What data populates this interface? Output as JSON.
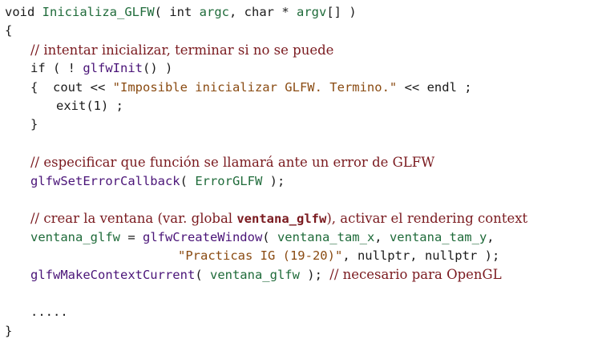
{
  "code": {
    "l1": {
      "kw_void": "void",
      "fname": "Inicializa_GLFW",
      "open": "( ",
      "kw_int": "int",
      "argc": "argc",
      "comma": ", ",
      "kw_char": "char",
      "star": " * ",
      "argv": "argv",
      "close": "[] )"
    },
    "l2": {
      "brace": "{"
    },
    "l3": {
      "comment": "// intentar inicializar, terminar si no se puede"
    },
    "l4": {
      "pre": "if ( ! ",
      "call": "glfwInit",
      "post": "() )"
    },
    "l5": {
      "pre": "{  cout << ",
      "str": "\"Imposible inicializar GLFW. Termino.\"",
      "post": " << endl ;"
    },
    "l6": {
      "text": "exit(1) ;"
    },
    "l7": {
      "brace": "}"
    },
    "l8": {
      "comment": "// especificar que función se llamará ante un error de GLFW"
    },
    "l9": {
      "call": "glfwSetErrorCallback",
      "open": "( ",
      "arg": "ErrorGLFW",
      "close": " );"
    },
    "l10": {
      "comment_pre": "// crear la ventana (var. global ",
      "comment_var": "ventana_glfw",
      "comment_post": "), activar el rendering context"
    },
    "l11": {
      "lhs": "ventana_glfw",
      "eq": " = ",
      "call": "glfwCreateWindow",
      "open": "( ",
      "a1": "ventana_tam_x",
      "sep": ", ",
      "a2": "ventana_tam_y",
      "end": ","
    },
    "l12": {
      "str": "\"Practicas IG (19-20)\"",
      "post": ", nullptr, nullptr );"
    },
    "l13": {
      "call": "glfwMakeContextCurrent",
      "open": "( ",
      "arg": "ventana_glfw",
      "close": " ); ",
      "comment": "// necesario para OpenGL"
    },
    "l14": {
      "dots": "....."
    },
    "l15": {
      "brace": "}"
    }
  }
}
